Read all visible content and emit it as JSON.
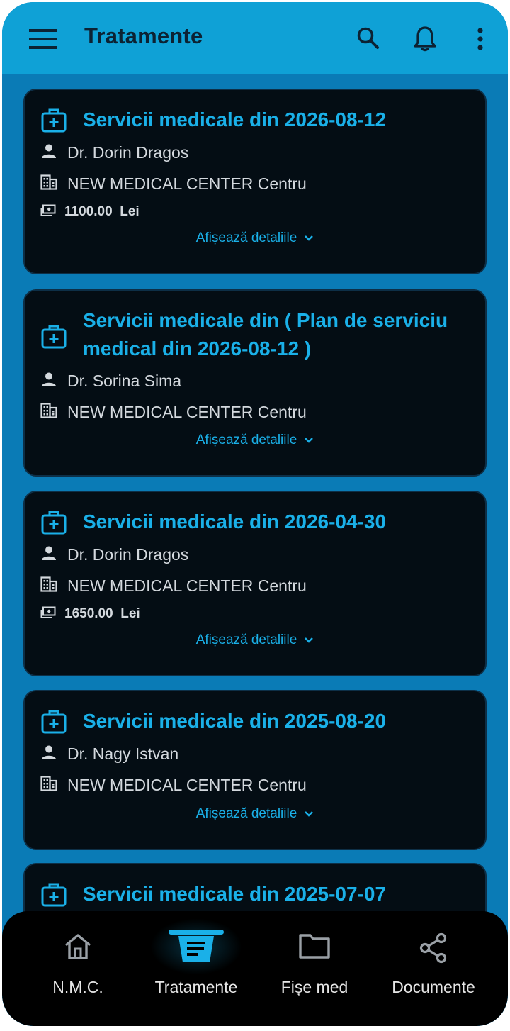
{
  "appbar": {
    "title": "Tratamente",
    "icons": [
      "menu-icon",
      "search-icon",
      "bell-icon",
      "more-vert-icon"
    ]
  },
  "cards": [
    {
      "title": "Servicii medicale din 2026-08-12",
      "doctor": "Dr. Dorin Dragos",
      "clinic": "NEW MEDICAL CENTER Centru",
      "price": "1100.00  Lei",
      "details": "Afișează detaliile"
    },
    {
      "title_line1": "Servicii medicale din ( Plan de serviciu",
      "title_line2": "medical din 2026-08-12 )",
      "doctor": "Dr. Sorina Sima",
      "clinic": "NEW MEDICAL CENTER Centru",
      "details": "Afișează detaliile"
    },
    {
      "title": "Servicii medicale din 2026-04-30",
      "doctor": "Dr. Dorin Dragos",
      "clinic": "NEW MEDICAL CENTER Centru",
      "price": "1650.00  Lei",
      "details": "Afișează detaliile"
    },
    {
      "title": "Servicii medicale din 2025-08-20",
      "doctor": "Dr. Nagy Istvan",
      "clinic": "NEW MEDICAL CENTER Centru",
      "details": "Afișează detaliile"
    },
    {
      "title": "Servicii medicale din 2025-07-07"
    }
  ],
  "navbar": {
    "items": [
      {
        "label": "N.M.C.",
        "icon": "home-icon"
      },
      {
        "label": "Tratamente",
        "icon": "treatments-icon",
        "active": true
      },
      {
        "label": "Fișe med",
        "icon": "folder-icon"
      },
      {
        "label": "Documente",
        "icon": "share-icon"
      }
    ]
  },
  "colors": {
    "appbar": "#0fa1d6",
    "background": "#0a7bb6",
    "card": "#040d14",
    "accent": "#1ab0e8"
  }
}
